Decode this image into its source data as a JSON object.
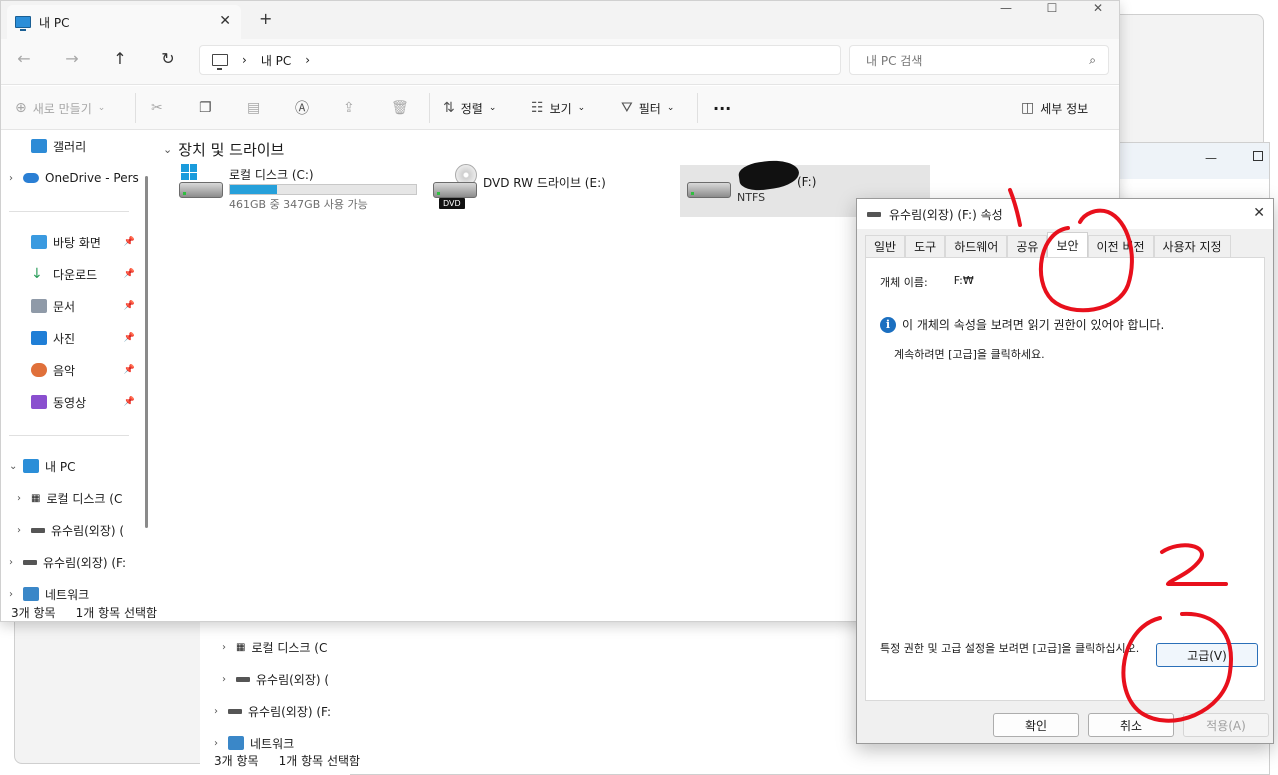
{
  "explorer": {
    "tab_title": "내 PC",
    "tab_close": "✕",
    "new_tab": "+",
    "breadcrumb": [
      "내 PC"
    ],
    "breadcrumb_sep": "›",
    "search_placeholder": "내 PC 검색",
    "toolbar": {
      "new_label": "새로 만들기",
      "sort_label": "정렬",
      "view_label": "보기",
      "filter_label": "필터",
      "more": "···",
      "details_label": "세부 정보"
    },
    "nav": {
      "gallery": "갤러리",
      "onedrive": "OneDrive - Pers",
      "desktop": "바탕 화면",
      "downloads": "다운로드",
      "documents": "문서",
      "pictures": "사진",
      "music": "음악",
      "videos": "동영상",
      "this_pc": "내 PC",
      "local_disk": "로컬 디스크 (C",
      "external1": "유수림(외장) (",
      "external2": "유수림(외장) (F:",
      "network": "네트워크"
    },
    "group_header": "장치 및 드라이브",
    "drives": [
      {
        "name": "로컬 디스크 (C:)",
        "sub": "461GB 중 347GB 사용 가능",
        "used_fraction": 0.25
      },
      {
        "name": "DVD RW 드라이브 (E:)",
        "sub": "",
        "badge": "DVD"
      },
      {
        "name": "(F:)",
        "sub": "NTFS"
      }
    ],
    "status": {
      "items": "3개 항목",
      "selected": "1개 항목 선택함"
    }
  },
  "background": {
    "nav": {
      "local_disk": "로컬 디스크 (C",
      "external1": "유수림(외장) (",
      "external2": "유수림(외장) (F:",
      "network": "네트워크"
    },
    "status": {
      "items": "3개 항목",
      "selected": "1개 항목 선택함"
    }
  },
  "dialog": {
    "title": "유수림(외장) (F:) 속성",
    "close": "✕",
    "tabs": [
      "일반",
      "도구",
      "하드웨어",
      "공유",
      "보안",
      "이전 버전",
      "사용자 지정"
    ],
    "active_tab": "보안",
    "object_label": "개체 이름:",
    "object_value": "F:₩",
    "info_text": "이 개체의 속성을 보려면 읽기 권한이 있어야 합니다.",
    "continue_text": "계속하려면 [고급]을 클릭하세요.",
    "advanced_desc": "특정 권한 및 고급 설정을 보려면 [고급]을 클릭하십시오.",
    "advanced_button": "고급(V)",
    "ok": "확인",
    "cancel": "취소",
    "apply": "적용(A)"
  },
  "colors": {
    "accent": "#26a0da",
    "annotation": "#e8101c"
  }
}
